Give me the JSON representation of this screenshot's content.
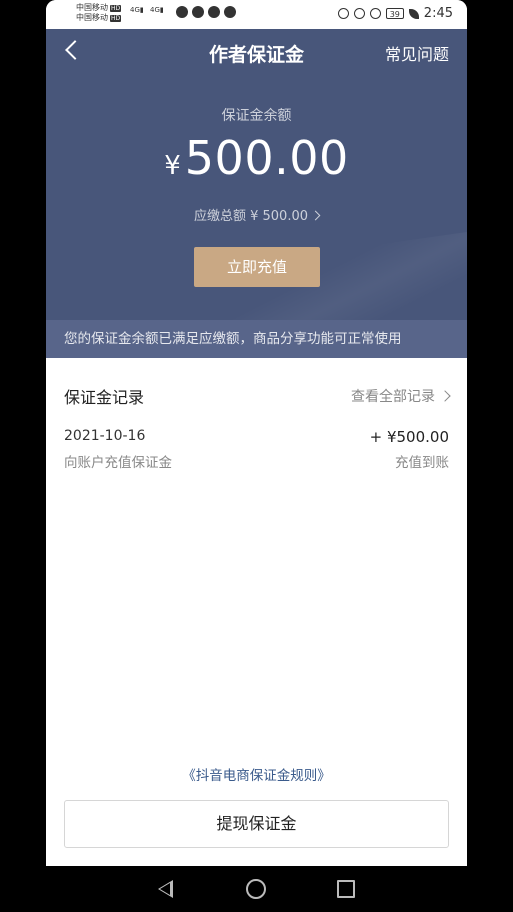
{
  "status_bar": {
    "carrier1": "中国移动",
    "carrier2": "中国移动",
    "hd": "HD",
    "net1": "4G",
    "net2": "4G",
    "battery": "39",
    "time": "2:45"
  },
  "header": {
    "title": "作者保证金",
    "faq_label": "常见问题"
  },
  "balance": {
    "label": "保证金余额",
    "currency": "¥",
    "amount": "500.00",
    "due_text": "应缴总额 ¥ 500.00",
    "recharge_label": "立即充值"
  },
  "notice": "您的保证金余额已满足应缴额，商品分享功能可正常使用",
  "records": {
    "title": "保证金记录",
    "view_all": "查看全部记录",
    "items": [
      {
        "date": "2021-10-16",
        "desc": "向账户充值保证金",
        "amount": "+ ¥500.00",
        "status": "充值到账"
      }
    ]
  },
  "rules_link": "《抖音电商保证金规则》",
  "withdraw_label": "提现保证金"
}
